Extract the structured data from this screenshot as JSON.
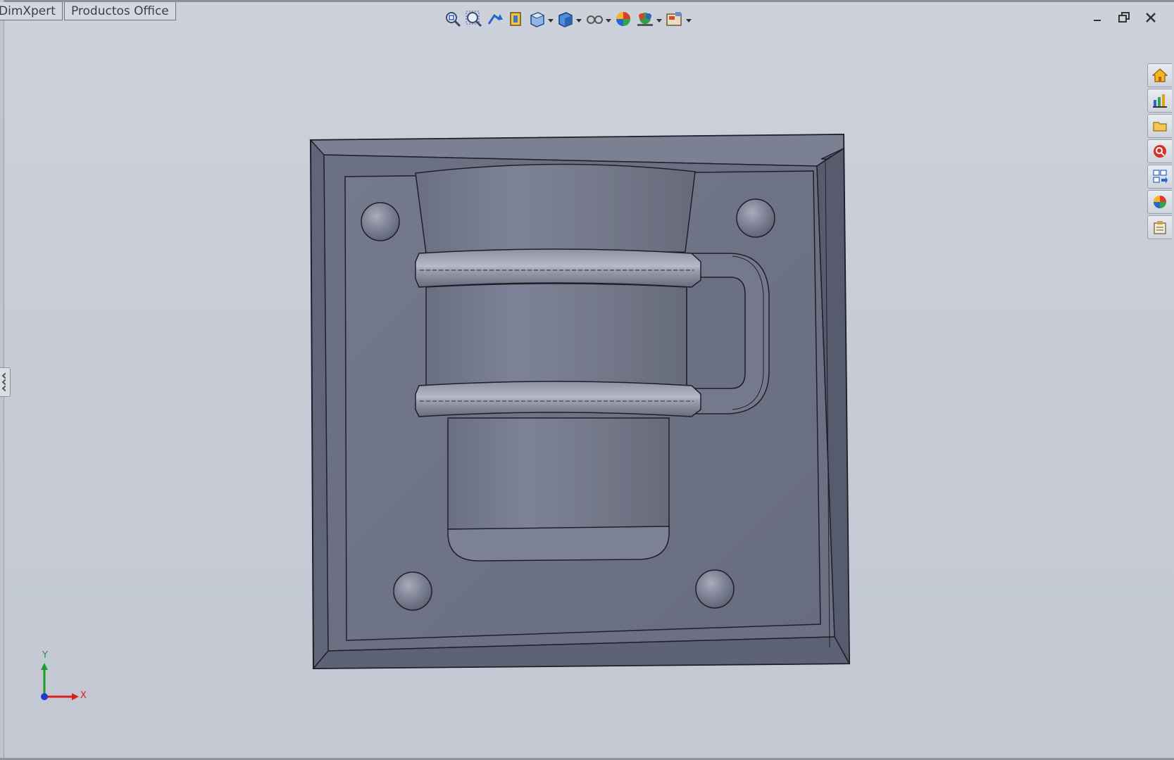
{
  "tabs": [
    {
      "label": "DimXpert"
    },
    {
      "label": "Productos Office"
    }
  ],
  "toolbar_icons": [
    "zoom-to-fit-icon",
    "zoom-to-area-icon",
    "previous-view-icon",
    "section-view-icon",
    "view-orientation-icon",
    "display-style-icon",
    "hide-show-items-icon",
    "edit-appearance-icon",
    "apply-scene-icon",
    "view-settings-icon"
  ],
  "window_controls": [
    "minimize-icon",
    "restore-icon",
    "close-icon"
  ],
  "task_pane": [
    "home-icon",
    "design-library-icon",
    "file-explorer-icon",
    "search-icon",
    "view-palette-icon",
    "appearances-icon",
    "custom-properties-icon"
  ],
  "triad": {
    "x_label": "X",
    "y_label": "Y"
  },
  "colors": {
    "viewport_bg": "#c9ced8",
    "part_face": "#6f7486",
    "part_edge": "#1e2028",
    "axis_x": "#d81e1e",
    "axis_y": "#1e9e2c",
    "axis_z": "#1e3cc8"
  }
}
